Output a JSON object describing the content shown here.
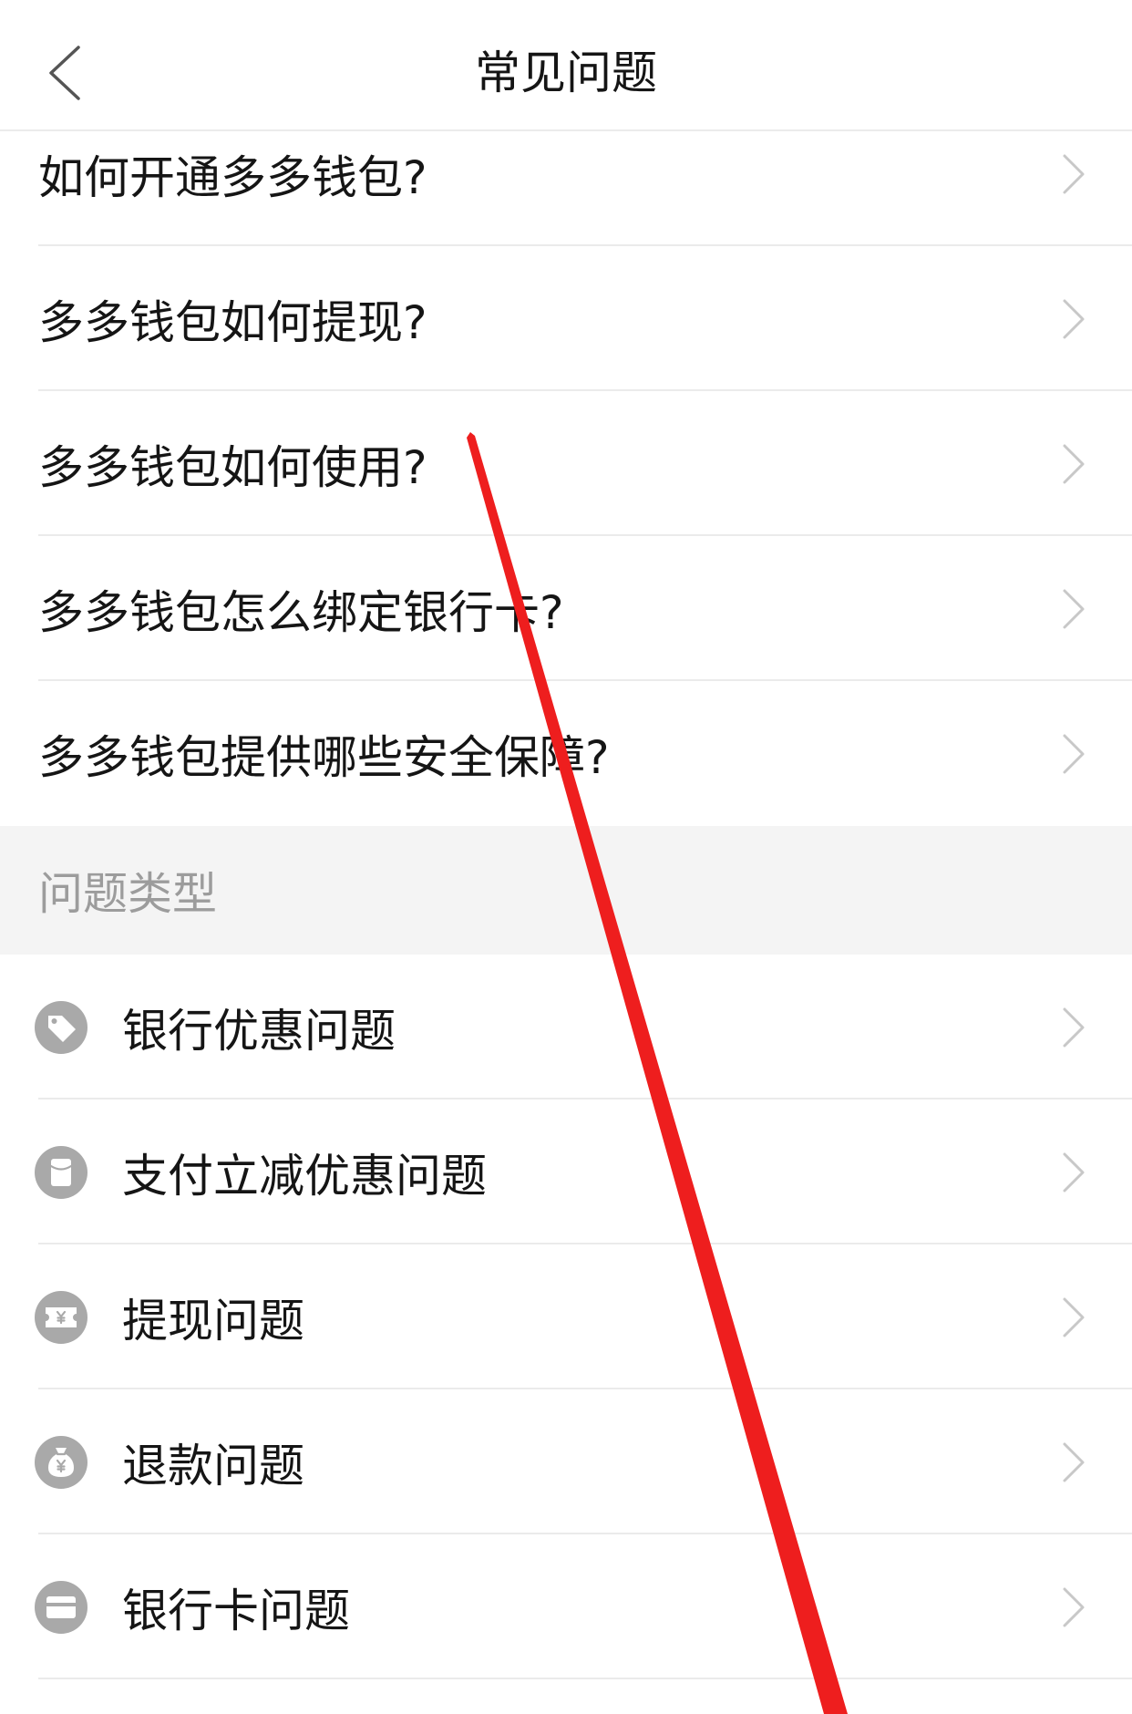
{
  "header": {
    "title": "常见问题",
    "back_icon": "chevron-left-icon"
  },
  "faq": {
    "items": [
      {
        "label": "如何开通多多钱包?"
      },
      {
        "label": "多多钱包如何提现?"
      },
      {
        "label": "多多钱包如何使用?"
      },
      {
        "label": "多多钱包怎么绑定银行卡?"
      },
      {
        "label": "多多钱包提供哪些安全保障?"
      }
    ],
    "row_icon": "chevron-right-icon"
  },
  "categories": {
    "title": "问题类型",
    "items": [
      {
        "label": "银行优惠问题",
        "icon": "tag-icon"
      },
      {
        "label": "支付立减优惠问题",
        "icon": "red-envelope-icon"
      },
      {
        "label": "提现问题",
        "icon": "yuan-ticket-icon"
      },
      {
        "label": "退款问题",
        "icon": "money-bag-icon"
      },
      {
        "label": "银行卡问题",
        "icon": "bank-card-icon"
      }
    ]
  },
  "annotation": {
    "type": "red-hand-drawn-stroke"
  },
  "colors": {
    "text_primary": "#151515",
    "text_secondary": "#9c9c9c",
    "divider": "#ebebeb",
    "section_bg": "#f4f4f4",
    "icon_gray": "#a9a9a9",
    "chevron": "#c8c8c8",
    "back_arrow": "#555555",
    "annotation_red": "#ee1e1e"
  }
}
